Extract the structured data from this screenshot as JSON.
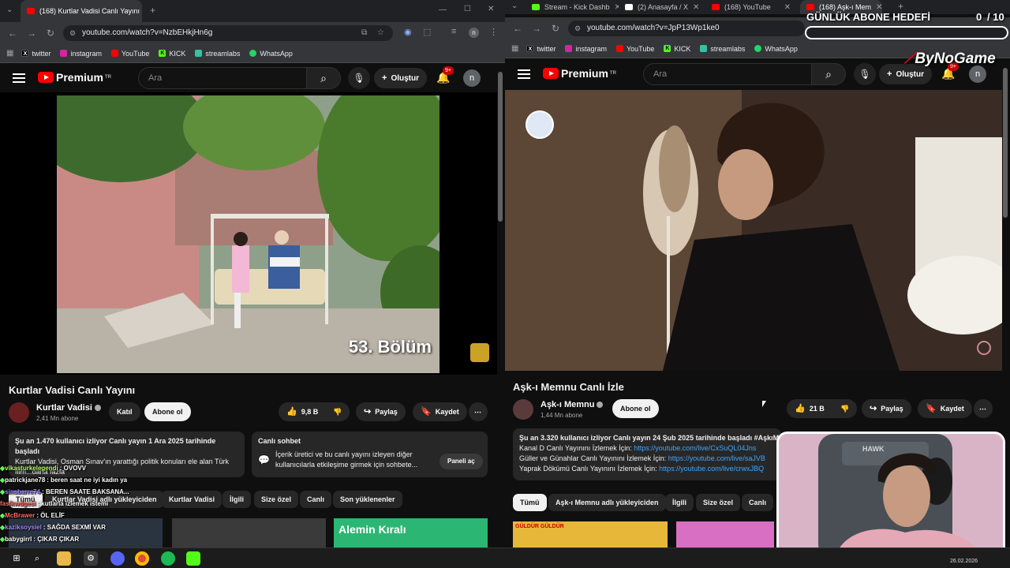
{
  "left": {
    "tabs": [
      {
        "label": "(168) Kurtlar Vadisi Canlı Yayını"
      }
    ],
    "url": "youtube.com/watch?v=NzbEHkjHn6g",
    "bookmarks": [
      {
        "label": "twitter",
        "icon": "x-icon",
        "color": "#000000"
      },
      {
        "label": "instagram",
        "icon": "instagram-icon",
        "color": "#d6249f"
      },
      {
        "label": "YouTube",
        "icon": "youtube-icon",
        "color": "#ff0000"
      },
      {
        "label": "KICK",
        "icon": "kick-icon",
        "color": "#53fc18"
      },
      {
        "label": "streamlabs",
        "icon": "streamlabs-icon",
        "color": "#31c3a2"
      },
      {
        "label": "WhatsApp",
        "icon": "whatsapp-icon",
        "color": "#25d366"
      }
    ],
    "header": {
      "logo": "Premium",
      "region": "TR",
      "search_placeholder": "Ara",
      "create": "Oluştur",
      "notif": "9+",
      "avatar": "n"
    },
    "video": {
      "overlay": "53. Bölüm",
      "title": "Kurtlar Vadisi Canlı Yayını"
    },
    "channel": {
      "name": "Kurtlar Vadisi",
      "subs": "2,41 Mn abone",
      "join": "Katıl",
      "subscribe": "Abone ol"
    },
    "actions": {
      "likes": "9,8 B",
      "share": "Paylaş",
      "save": "Kaydet"
    },
    "description": {
      "line1": "Şu an 1.470 kullanıcı izliyor  Canlı yayın 1 Ara 2025 tarihinde başladı",
      "line2": "Kurtlar Vadisi, Osman Sınav'ın yarattığı politik konuları ele alan Türk",
      "line3": "film...daha fazla"
    },
    "chat": {
      "title": "Canlı sohbet",
      "text1": "İçerik üretici ve bu canlı yayını izleyen diğer",
      "text2": "kullanıcılarla etkileşime girmek için sohbete...",
      "button": "Paneli aç"
    },
    "chips": [
      "Tümü",
      "Kurtlar Vadisi adlı yükleyiciden",
      "Kurtlar Vadisi",
      "İlgili",
      "Sizе özel",
      "Canlı",
      "Son yüklenenler"
    ],
    "thumb3": "Alemin Kıralı"
  },
  "right": {
    "tabs": [
      {
        "label": "Stream - Kick Dashb",
        "color": "#53fc18"
      },
      {
        "label": "(2) Anasayfa / X",
        "color": "#ffffff"
      },
      {
        "label": "(168) YouTube",
        "color": "#ff0000"
      },
      {
        "label": "(168) Aşk-ı Mem",
        "color": "#ff0000"
      }
    ],
    "url": "youtube.com/watch?v=JpP13Wp1ke0",
    "header": {
      "logo": "Premium",
      "region": "TR",
      "search_placeholder": "Ara",
      "create": "Oluştur",
      "notif": "9+",
      "avatar": "n"
    },
    "video": {
      "title": "Aşk-ı Memnu Canlı İzle"
    },
    "channel": {
      "name": "Aşk-ı Memnu",
      "subs": "1,44 Mn abone",
      "subscribe": "Abone ol"
    },
    "actions": {
      "likes": "21 B",
      "share": "Paylaş",
      "save": "Kaydet"
    },
    "description": {
      "line1": "Şu an 3.320 kullanıcı izliyor  Canlı yayın 24 Şub 2025 tarihinde başladı  #AşkıMe",
      "l2a": "Kanal D Canlı Yayınını İzlemek İçin: ",
      "l2b": "https://youtube.com/live/CxSuQL04Jns",
      "l3a": "Güller ve Günahlar Canlı Yayınını İzlemek İçin: ",
      "l3b": "https://youtube.com/live/saJVB",
      "l4a": "Yaprak Dökümü Canlı Yayınını İzlemek İçin: ",
      "l4b": "https://youtube.com/live/crwxJBQ"
    },
    "chips": [
      "Tümü",
      "Aşk-ı Memnu adlı yükleyiciden",
      "İlgili",
      "Size özel",
      "Canlı"
    ],
    "thumb1": "GÜLDÜR GÜLDÜR"
  },
  "stream_overlay": {
    "goal_label": "GÜNLÜK ABONE HEDEFİ",
    "goal_count": "0",
    "goal_total": "/ 10",
    "goal_progress": 0,
    "brand": "ByNoGame",
    "cam_chair": "HAWK",
    "chat": [
      {
        "user": "vikasturkelegendi",
        "msg": ": OVOVV",
        "color": "#b7ff6b"
      },
      {
        "user": "patrickjane78",
        "msg": ": beren saat ne iyi kadın ya",
        "color": "#ffffff"
      },
      {
        "user": "sinsbarre74",
        "msg": ": BEREN SAATE BAKSANA...",
        "color": "#9a7dff"
      },
      {
        "user": "faslkwdgesi",
        "msg": ": kutlarla izlemek istemi",
        "color": "#ff6b6b"
      },
      {
        "user": "McBrawer",
        "msg": ": ÖL ELİF",
        "color": "#ff6b6b"
      },
      {
        "user": "kaziksoysiel",
        "msg": ": SAĞDA SEXMİ VAR",
        "color": "#a58bff"
      },
      {
        "user": "babygirrl",
        "msg": ": ÇIKAR ÇIKAR",
        "color": "#ffffff"
      }
    ]
  },
  "taskbar": {
    "date": "26.02.2026"
  }
}
